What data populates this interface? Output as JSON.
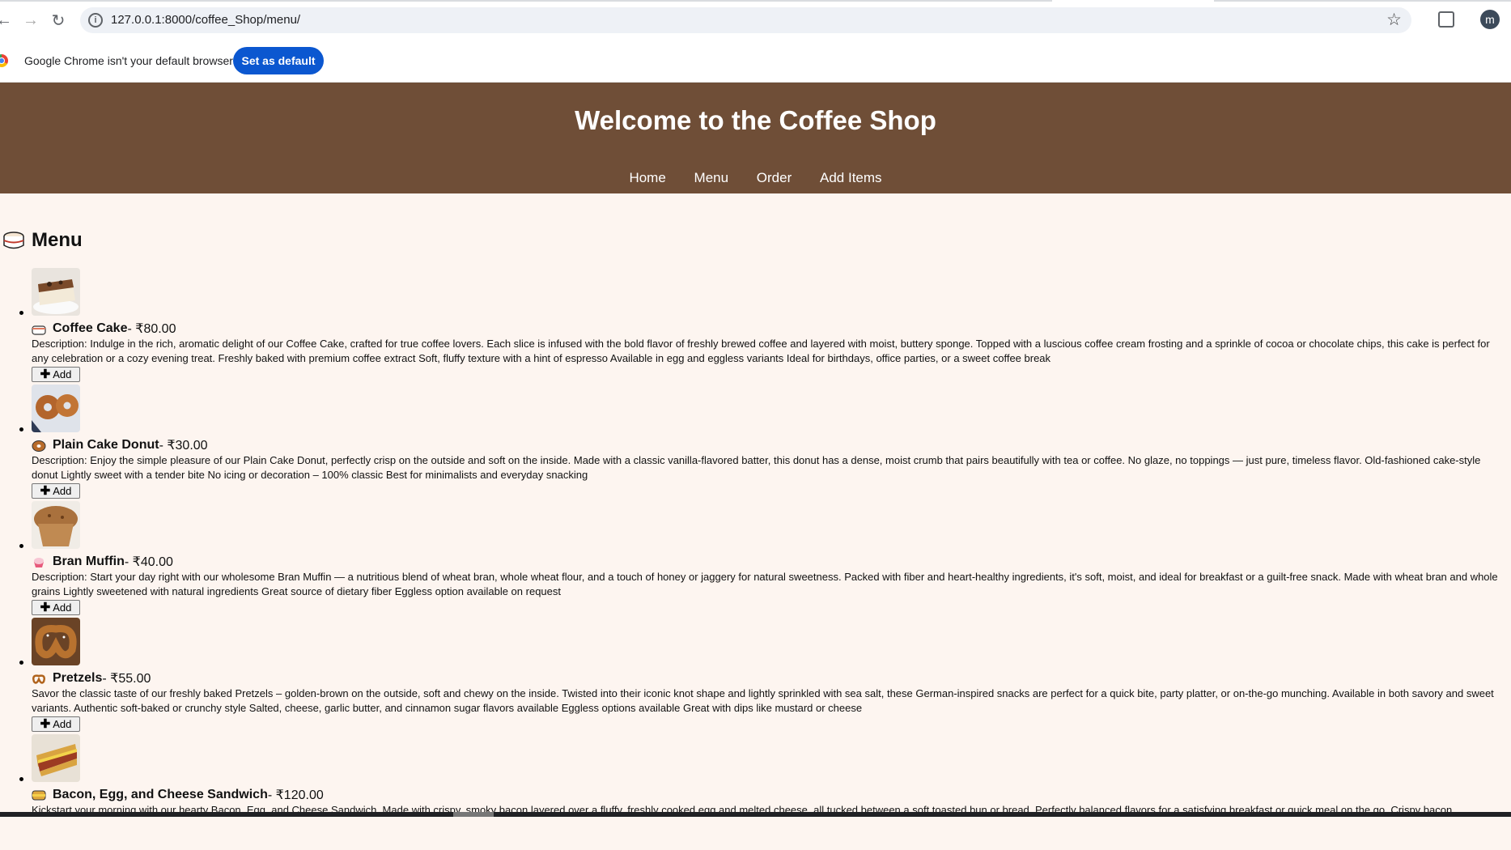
{
  "browser": {
    "url": "127.0.0.1:8000/coffee_Shop/menu/",
    "profile_initial": "m",
    "infobar_message": "Google Chrome isn't your default browser",
    "set_default_label": "Set as default"
  },
  "header": {
    "title": "Welcome to the Coffee Shop",
    "nav": [
      "Home",
      "Menu",
      "Order",
      "Add Items"
    ]
  },
  "menu": {
    "title": "Menu",
    "add_label": "Add",
    "items": [
      {
        "name": "Coffee Cake",
        "price": " - ₹80.00",
        "description": "Description: Indulge in the rich, aromatic delight of our Coffee Cake, crafted for true coffee lovers. Each slice is infused with the bold flavor of freshly brewed coffee and layered with moist, buttery sponge. Topped with a luscious coffee cream frosting and a sprinkle of cocoa or chocolate chips, this cake is perfect for any celebration or a cozy evening treat. Freshly baked with premium coffee extract Soft, fluffy texture with a hint of espresso Available in egg and eggless variants Ideal for birthdays, office parties, or a sweet coffee break",
        "icon": "cake-icon"
      },
      {
        "name": "Plain Cake Donut",
        "price": " - ₹30.00",
        "description": "Description: Enjoy the simple pleasure of our Plain Cake Donut, perfectly crisp on the outside and soft on the inside. Made with a classic vanilla-flavored batter, this donut has a dense, moist crumb that pairs beautifully with tea or coffee. No glaze, no toppings — just pure, timeless flavor. Old-fashioned cake-style donut Lightly sweet with a tender bite No icing or decoration – 100% classic Best for minimalists and everyday snacking",
        "icon": "donut-icon"
      },
      {
        "name": "Bran Muffin",
        "price": " - ₹40.00",
        "description": "Description: Start your day right with our wholesome Bran Muffin — a nutritious blend of wheat bran, whole wheat flour, and a touch of honey or jaggery for natural sweetness. Packed with fiber and heart-healthy ingredients, it's soft, moist, and ideal for breakfast or a guilt-free snack. Made with wheat bran and whole grains Lightly sweetened with natural ingredients Great source of dietary fiber Eggless option available on request",
        "icon": "cupcake-icon"
      },
      {
        "name": "Pretzels",
        "price": " - ₹55.00",
        "description": "Savor the classic taste of our freshly baked Pretzels – golden-brown on the outside, soft and chewy on the inside. Twisted into their iconic knot shape and lightly sprinkled with sea salt, these German-inspired snacks are perfect for a quick bite, party platter, or on-the-go munching. Available in both savory and sweet variants. Authentic soft-baked or crunchy style Salted, cheese, garlic butter, and cinnamon sugar flavors available Eggless options available Great with dips like mustard or cheese",
        "icon": "pretzel-icon"
      },
      {
        "name": "Bacon, Egg, and Cheese Sandwich",
        "price": " - ₹120.00",
        "description": "Kickstart your morning with our hearty Bacon, Egg, and Cheese Sandwich. Made with crispy, smoky bacon layered over a fluffy, freshly cooked egg and melted cheese, all tucked between a soft toasted bun or bread. Perfectly balanced flavors for a satisfying breakfast or quick meal on the go. Crispy bacon",
        "icon": "sandwich-icon"
      }
    ]
  },
  "colors": {
    "header_bg": "#6f4e37",
    "page_bg": "#fdf5f0",
    "button_blue": "#0b57d0"
  }
}
